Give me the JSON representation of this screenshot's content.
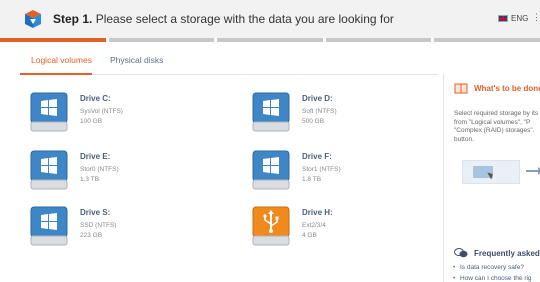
{
  "header": {
    "step_label": "Step 1.",
    "title": "Please select a storage with the data you are looking for",
    "language": "ENG"
  },
  "progress": {
    "segments": 5,
    "active_index": 0
  },
  "tabs": [
    {
      "label": "Logical volumes",
      "active": true
    },
    {
      "label": "Physical disks",
      "active": false
    }
  ],
  "drives": [
    {
      "name": "Drive C:",
      "fs": "SysVol (NTFS)",
      "size": "100 GB",
      "icon": "windows-drive-icon"
    },
    {
      "name": "Drive D:",
      "fs": "Soft (NTFS)",
      "size": "500 GB",
      "icon": "windows-drive-icon"
    },
    {
      "name": "Drive E:",
      "fs": "Stor0 (NTFS)",
      "size": "1.3 TB",
      "icon": "windows-drive-icon"
    },
    {
      "name": "Drive F:",
      "fs": "Stor1 (NTFS)",
      "size": "1.8 TB",
      "icon": "windows-drive-icon"
    },
    {
      "name": "Drive S:",
      "fs": "SSD (NTFS)",
      "size": "223 GB",
      "icon": "windows-drive-icon"
    },
    {
      "name": "Drive H:",
      "fs": "Ext2/3/4",
      "size": "4 GB",
      "icon": "usb-drive-icon"
    }
  ],
  "panel": {
    "title": "What's to be done",
    "desc_lines": [
      "Select required storage by its",
      "from \"Logical volumes\", \"P",
      "\"Complex (RAID) storages\".",
      "button."
    ],
    "faq_title": "Frequently asked q",
    "faq_items": [
      "Is data recovery safe?",
      "How can I choose the rig"
    ]
  },
  "colors": {
    "accent": "#e2612b",
    "header_bg": "#f2f2f2",
    "drive_blue": "#3e86c6",
    "drive_orange": "#f08a1c"
  }
}
